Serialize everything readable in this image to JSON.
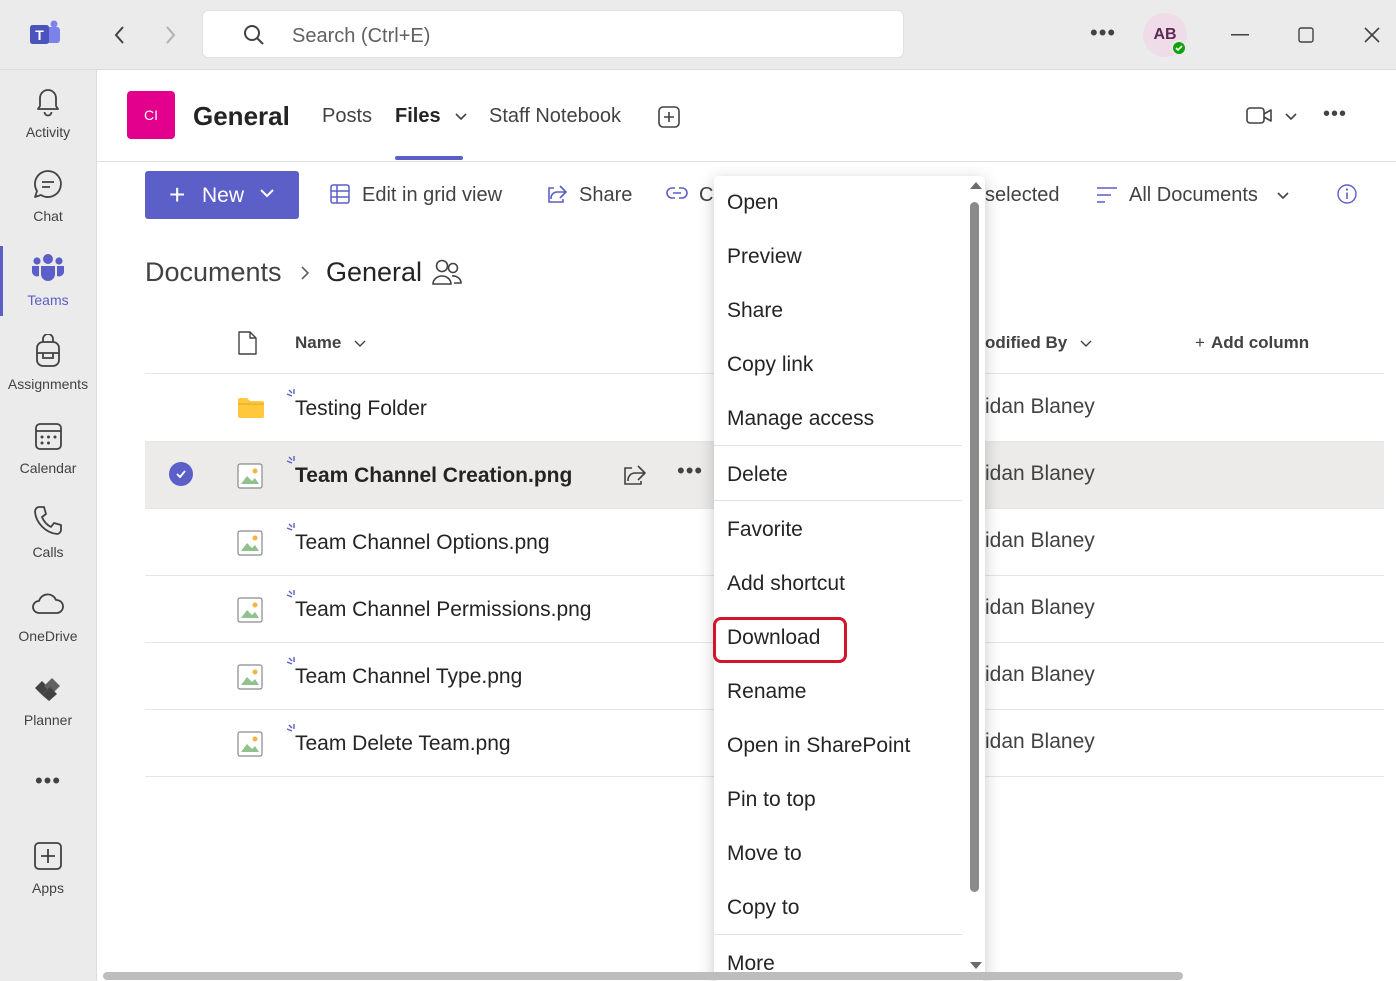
{
  "titlebar": {
    "search_placeholder": "Search (Ctrl+E)",
    "avatar_initials": "AB"
  },
  "rail": {
    "items": [
      {
        "label": "Activity"
      },
      {
        "label": "Chat"
      },
      {
        "label": "Teams"
      },
      {
        "label": "Assignments"
      },
      {
        "label": "Calendar"
      },
      {
        "label": "Calls"
      },
      {
        "label": "OneDrive"
      },
      {
        "label": "Planner"
      },
      {
        "label": "Apps"
      }
    ]
  },
  "channel": {
    "tile_initials": "CI",
    "title": "General",
    "tabs": [
      {
        "label": "Posts"
      },
      {
        "label": "Files"
      },
      {
        "label": "Staff Notebook"
      }
    ]
  },
  "commandbar": {
    "new_label": "New",
    "edit_grid_label": "Edit in grid view",
    "share_label": "Share",
    "copylink_partial": "C",
    "selected_partial": "selected",
    "view_label": "All Documents"
  },
  "breadcrumb": {
    "root": "Documents",
    "current": "General"
  },
  "list": {
    "col_name": "Name",
    "col_modified_by": "odified By",
    "col_add": "Add column",
    "rows": [
      {
        "name": "Testing Folder",
        "modified_by": "idan Blaney"
      },
      {
        "name": "Team Channel Creation.png",
        "modified_by": "idan Blaney"
      },
      {
        "name": "Team Channel Options.png",
        "modified_by": "idan Blaney"
      },
      {
        "name": "Team Channel Permissions.png",
        "modified_by": "idan Blaney"
      },
      {
        "name": "Team Channel Type.png",
        "modified_by": "idan Blaney"
      },
      {
        "name": "Team Delete Team.png",
        "modified_by": "idan Blaney"
      }
    ]
  },
  "context_menu": {
    "items": [
      {
        "label": "Open"
      },
      {
        "label": "Preview"
      },
      {
        "label": "Share"
      },
      {
        "label": "Copy link"
      },
      {
        "label": "Manage access"
      },
      {
        "label": "Delete"
      },
      {
        "label": "Favorite"
      },
      {
        "label": "Add shortcut"
      },
      {
        "label": "Download"
      },
      {
        "label": "Rename"
      },
      {
        "label": "Open in SharePoint"
      },
      {
        "label": "Pin to top"
      },
      {
        "label": "Move to"
      },
      {
        "label": "Copy to"
      },
      {
        "label": "More"
      }
    ]
  },
  "colors": {
    "accent": "#5b5fc7",
    "team_tile": "#e3008c",
    "highlight": "#d2152a",
    "folder": "#ffc83d",
    "presence": "#13a10e"
  }
}
